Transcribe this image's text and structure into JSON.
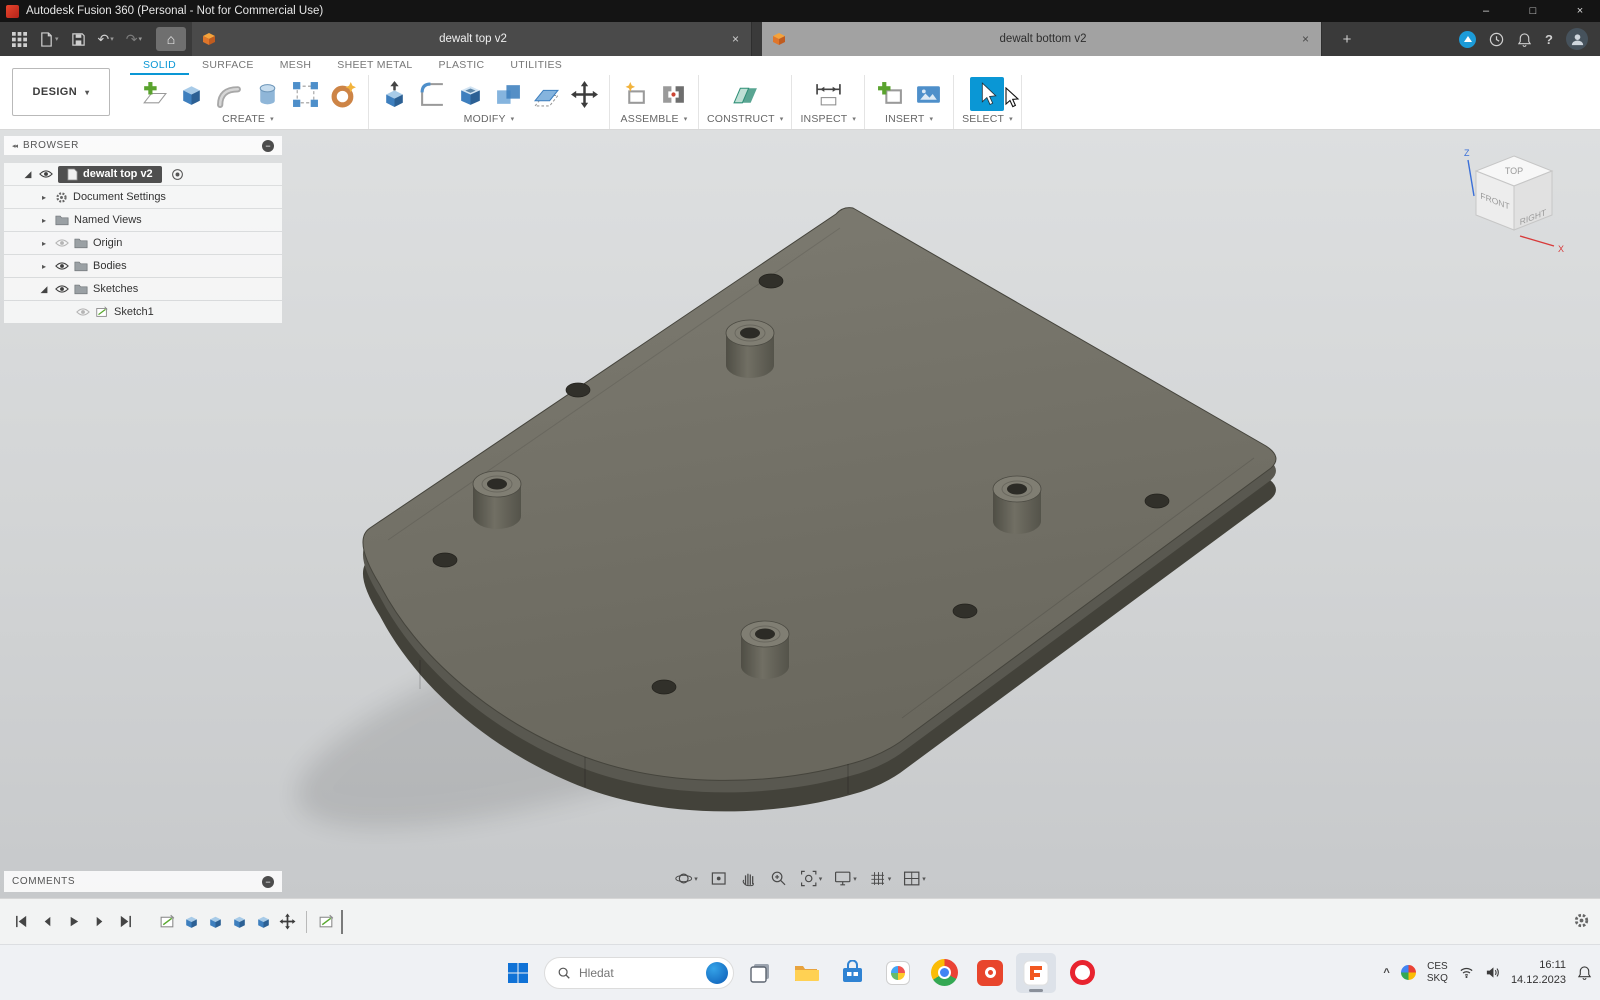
{
  "title_bar": {
    "title": "Autodesk Fusion 360 (Personal - Not for Commercial Use)"
  },
  "tabs": {
    "doc1": "dewalt top v2",
    "doc2": "dewalt bottom v2"
  },
  "ribbon": {
    "design_menu": "DESIGN",
    "tabs": [
      {
        "label": "SOLID"
      },
      {
        "label": "SURFACE"
      },
      {
        "label": "MESH"
      },
      {
        "label": "SHEET METAL"
      },
      {
        "label": "PLASTIC"
      },
      {
        "label": "UTILITIES"
      }
    ],
    "groups": [
      {
        "label": "CREATE"
      },
      {
        "label": "MODIFY"
      },
      {
        "label": "ASSEMBLE"
      },
      {
        "label": "CONSTRUCT"
      },
      {
        "label": "INSPECT"
      },
      {
        "label": "INSERT"
      },
      {
        "label": "SELECT"
      }
    ]
  },
  "browser": {
    "header": "BROWSER",
    "items": [
      {
        "label": "dewalt top v2"
      },
      {
        "label": "Document Settings"
      },
      {
        "label": "Named Views"
      },
      {
        "label": "Origin"
      },
      {
        "label": "Bodies"
      },
      {
        "label": "Sketches"
      },
      {
        "label": "Sketch1"
      }
    ]
  },
  "viewcube": {
    "top": "TOP",
    "front": "FRONT",
    "right": "RIGHT",
    "axis_x": "X",
    "axis_z": "Z"
  },
  "comments": {
    "label": "COMMENTS"
  },
  "taskbar": {
    "search_placeholder": "Hledat",
    "lang_line1": "CES",
    "lang_line2": "SKQ",
    "time": "16:11",
    "date": "14.12.2023"
  },
  "icons": {
    "caret_down": "▾",
    "close": "×",
    "plus": "+",
    "home": "⌂",
    "undo": "↶",
    "redo": "↷",
    "collapse_left": "◂◂",
    "minus": "−",
    "tri_right": "▸",
    "tri_open": "◢",
    "question": "?",
    "chevron_up": "^",
    "window_min": "–",
    "window_max": "□",
    "window_close": "×"
  }
}
